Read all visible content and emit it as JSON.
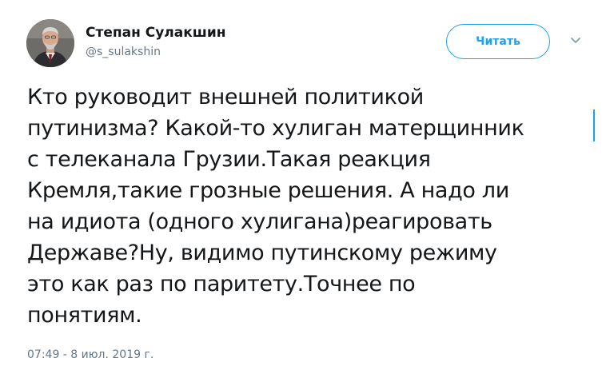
{
  "author": {
    "name": "Степан Сулакшин",
    "handle": "@s_sulakshin"
  },
  "actions": {
    "follow_label": "Читать"
  },
  "icons": {
    "avatar": "profile-photo",
    "caret": "chevron-down-icon"
  },
  "colors": {
    "accent": "#1da1f2",
    "text": "#14171a",
    "secondary": "#657786"
  },
  "tweet": {
    "lines": [
      "Кто руководит внешней политикой",
      "путинизма? Какой-то хулиган матерщинник",
      "с телеканала Грузии.Такая реакция",
      "Кремля,такие грозные решения. А надо ли",
      "на идиота (одного хулигана)реагировать",
      "Державе?Ну, видимо путинскому режиму",
      "это как раз по паритету.Точнее по",
      "понятиям."
    ],
    "timestamp": "07:49 - 8 июл. 2019 г."
  }
}
